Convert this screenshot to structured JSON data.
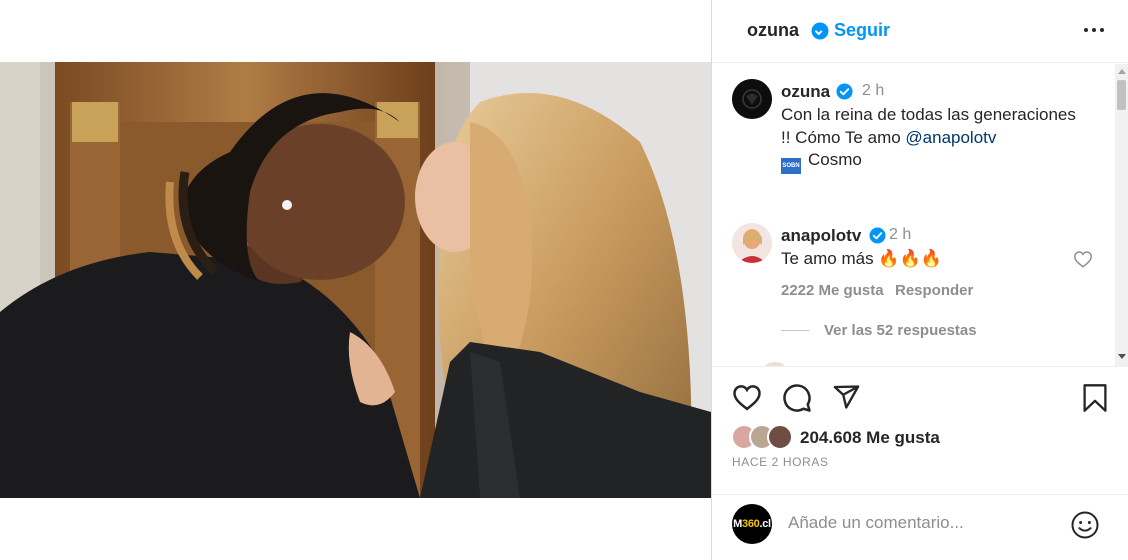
{
  "header": {
    "username": "ozuna",
    "separator": "•",
    "follow_label": "Seguir",
    "more_icon": "more-options-icon"
  },
  "caption": {
    "username": "ozuna",
    "time": "2 h",
    "text_line1": "Con la reina de todas las generaciones",
    "text_line2_prefix": "!! Cómo Te amo ",
    "mention": "@anapolotv",
    "location_icon": "sobn-location-badge-icon",
    "location_badge_text": "SOBN",
    "location": "Cosmo"
  },
  "comment": {
    "username": "anapolotv",
    "time": "2 h",
    "text": "Te amo más 🔥🔥🔥",
    "likes": "2222 Me gusta",
    "reply_label": "Responder",
    "view_replies": "Ver las 52 respuestas"
  },
  "actions": {
    "like_icon": "heart-icon",
    "comment_icon": "comment-icon",
    "share_icon": "share-icon",
    "save_icon": "bookmark-icon"
  },
  "likes": {
    "count_text": "204.608 Me gusta",
    "time_ago": "HACE 2 HORAS"
  },
  "add_comment": {
    "avatar_text_prefix": "M",
    "avatar_text_accent": "360",
    "avatar_text_suffix": ".cl",
    "placeholder": "Añade un comentario...",
    "emoji_icon": "emoji-icon"
  },
  "colors": {
    "accent": "#0095f6",
    "verified": "#0095f6",
    "muted": "#8e8e8e",
    "text": "#262626"
  }
}
